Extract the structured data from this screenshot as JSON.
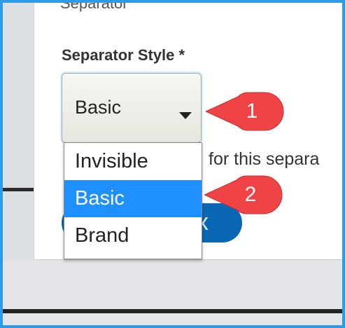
{
  "form": {
    "cut_heading": "Separator",
    "label": "Separator Style *",
    "select_value": "Basic",
    "help_text": "for this separa",
    "button_glyph": "x"
  },
  "dropdown": {
    "options": [
      {
        "label": "Invisible",
        "selected": false
      },
      {
        "label": "Basic",
        "selected": true
      },
      {
        "label": "Brand",
        "selected": false
      }
    ]
  },
  "annotations": {
    "step1": "1",
    "step2": "2",
    "callout_color": "#ef4346"
  },
  "colors": {
    "frame_border": "#2f9be6",
    "selection": "#1e90ff",
    "button": "#0a67b3"
  }
}
